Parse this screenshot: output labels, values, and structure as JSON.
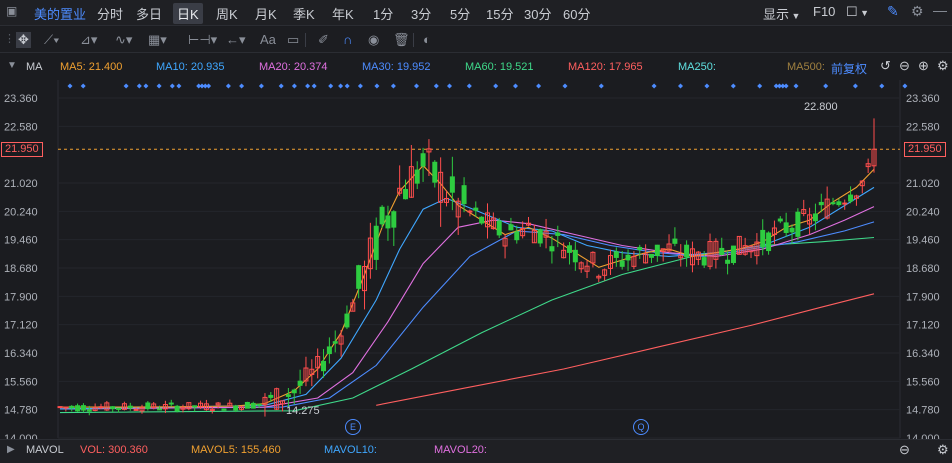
{
  "header": {
    "stock_name": "美的置业",
    "periods": [
      "分时",
      "多日",
      "日K",
      "周K",
      "月K",
      "季K",
      "年K",
      "1分",
      "3分",
      "5分",
      "15分",
      "30分",
      "60分"
    ],
    "selected_period": "日K",
    "display_label": "显示",
    "f10_label": "F10"
  },
  "toolbar": {
    "text_tool": "Aa"
  },
  "ma_bar": {
    "label": "MA",
    "ma5": "MA5: 21.400",
    "ma10": "MA10: 20.935",
    "ma20": "MA20: 20.374",
    "ma30": "MA30: 19.952",
    "ma60": "MA60: 19.521",
    "ma120": "MA120: 17.965",
    "ma250": "MA250:",
    "ma500": "MA500:",
    "adjust": "前复权"
  },
  "colors": {
    "up": "#ff4d4d",
    "down": "#2ecc40",
    "ma5": "#f0a030",
    "ma10": "#3fa7ff",
    "ma20": "#e070e0",
    "ma30": "#4d8cff",
    "ma60": "#3fd98a",
    "ma120": "#ff5f5f",
    "ma250": "#5fe0e0",
    "ma500": "#a08040"
  },
  "volume_bar": {
    "label": "MAVOL",
    "vol": "VOL: 300.360",
    "mavol5": "MAVOL5: 155.460",
    "mavol10": "MAVOL10:",
    "mavol20": "MAVOL20:"
  },
  "markers": {
    "e_label": "E",
    "q_label": "Q"
  },
  "chart_data": {
    "type": "candlestick",
    "y_ticks": [
      "23.360",
      "22.580",
      "21.950",
      "21.020",
      "20.240",
      "19.460",
      "18.680",
      "17.900",
      "17.120",
      "16.340",
      "15.560",
      "14.780",
      "14.000"
    ],
    "ylim": [
      14.0,
      23.36
    ],
    "current_price": 21.95,
    "current_price_label": "21.950",
    "high_label": "22.800",
    "low_label": "14.275",
    "ma5_path": [
      [
        0,
        14.85
      ],
      [
        10,
        14.85
      ],
      [
        20,
        14.86
      ],
      [
        30,
        14.88
      ],
      [
        35,
        14.95
      ],
      [
        40,
        15.3
      ],
      [
        44,
        15.9
      ],
      [
        48,
        16.9
      ],
      [
        52,
        18.5
      ],
      [
        55,
        19.8
      ],
      [
        58,
        20.8
      ],
      [
        62,
        21.5
      ],
      [
        65,
        21.0
      ],
      [
        68,
        20.4
      ],
      [
        72,
        20.0
      ],
      [
        76,
        19.6
      ],
      [
        80,
        19.8
      ],
      [
        84,
        19.5
      ],
      [
        88,
        19.1
      ],
      [
        92,
        18.7
      ],
      [
        96,
        18.9
      ],
      [
        100,
        19.1
      ],
      [
        104,
        19.2
      ],
      [
        108,
        19.0
      ],
      [
        112,
        19.1
      ],
      [
        116,
        19.2
      ],
      [
        120,
        19.4
      ],
      [
        124,
        19.8
      ],
      [
        128,
        20.0
      ],
      [
        132,
        20.5
      ],
      [
        136,
        20.9
      ],
      [
        139,
        21.4
      ]
    ],
    "ma10_path": [
      [
        0,
        14.8
      ],
      [
        20,
        14.85
      ],
      [
        35,
        14.9
      ],
      [
        42,
        15.2
      ],
      [
        48,
        16.2
      ],
      [
        54,
        17.8
      ],
      [
        58,
        19.2
      ],
      [
        62,
        20.3
      ],
      [
        66,
        20.6
      ],
      [
        72,
        20.2
      ],
      [
        78,
        19.8
      ],
      [
        84,
        19.7
      ],
      [
        90,
        19.3
      ],
      [
        96,
        19.1
      ],
      [
        104,
        19.0
      ],
      [
        112,
        19.1
      ],
      [
        120,
        19.3
      ],
      [
        128,
        19.8
      ],
      [
        134,
        20.4
      ],
      [
        139,
        20.9
      ]
    ],
    "ma20_path": [
      [
        0,
        14.8
      ],
      [
        35,
        14.85
      ],
      [
        44,
        15.1
      ],
      [
        50,
        15.8
      ],
      [
        56,
        17.2
      ],
      [
        62,
        18.8
      ],
      [
        68,
        19.8
      ],
      [
        74,
        20.0
      ],
      [
        80,
        19.9
      ],
      [
        88,
        19.6
      ],
      [
        96,
        19.3
      ],
      [
        104,
        19.1
      ],
      [
        112,
        19.0
      ],
      [
        120,
        19.2
      ],
      [
        128,
        19.6
      ],
      [
        134,
        20.0
      ],
      [
        139,
        20.37
      ]
    ],
    "ma30_path": [
      [
        0,
        14.8
      ],
      [
        38,
        14.85
      ],
      [
        46,
        15.1
      ],
      [
        54,
        16.0
      ],
      [
        62,
        17.6
      ],
      [
        70,
        19.0
      ],
      [
        78,
        19.7
      ],
      [
        86,
        19.6
      ],
      [
        94,
        19.3
      ],
      [
        102,
        19.1
      ],
      [
        110,
        19.0
      ],
      [
        118,
        19.2
      ],
      [
        126,
        19.4
      ],
      [
        134,
        19.7
      ],
      [
        139,
        19.95
      ]
    ],
    "ma60_path": [
      [
        0,
        14.7
      ],
      [
        40,
        14.75
      ],
      [
        50,
        15.1
      ],
      [
        60,
        15.9
      ],
      [
        72,
        16.9
      ],
      [
        84,
        17.8
      ],
      [
        96,
        18.5
      ],
      [
        108,
        19.0
      ],
      [
        120,
        19.3
      ],
      [
        130,
        19.4
      ],
      [
        139,
        19.52
      ]
    ],
    "ma120_path": [
      [
        54,
        14.9
      ],
      [
        70,
        15.4
      ],
      [
        86,
        15.9
      ],
      [
        102,
        16.5
      ],
      [
        118,
        17.1
      ],
      [
        130,
        17.6
      ],
      [
        139,
        17.97
      ]
    ]
  }
}
